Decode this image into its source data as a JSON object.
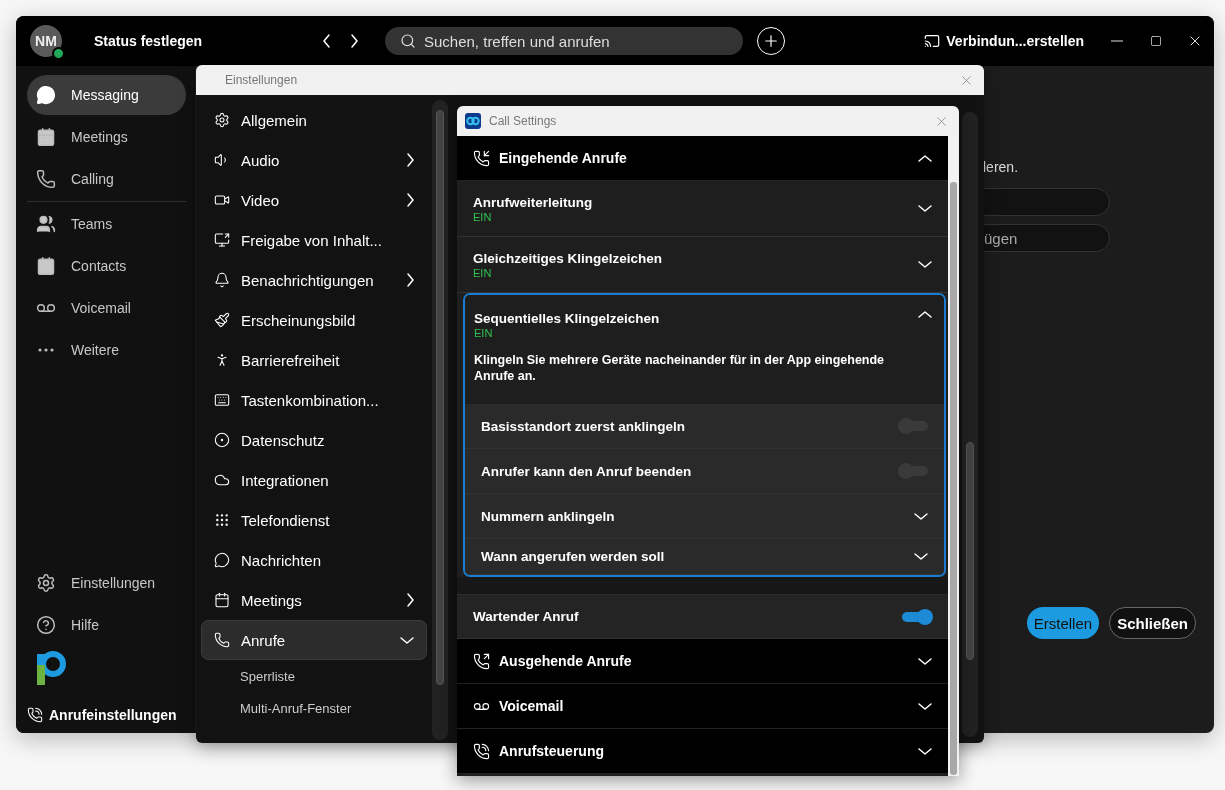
{
  "title_bar": {
    "avatar_initials": "NM",
    "status": "Status festlegen",
    "search": {
      "placeholder": "Suchen, treffen und anrufen"
    },
    "connect": "Verbindun...erstellen"
  },
  "sidebar": {
    "groups": [
      {
        "items": [
          {
            "label": "Messaging",
            "selected": true
          },
          {
            "label": "Meetings",
            "selected": false
          },
          {
            "label": "Calling",
            "selected": false
          }
        ]
      },
      {
        "items": [
          {
            "label": "Teams",
            "selected": false
          },
          {
            "label": "Contacts",
            "selected": false
          },
          {
            "label": "Voicemail",
            "selected": false
          },
          {
            "label": "Weitere",
            "selected": false
          }
        ]
      }
    ],
    "footer_items": [
      {
        "label": "Einstellungen"
      },
      {
        "label": "Hilfe"
      }
    ],
    "call_settings_link": "Anrufeinstellungen"
  },
  "background_panel": {
    "text_fragment": "leren.",
    "fields": [
      {
        "kind": "empty"
      },
      {
        "kind": "filled",
        "value": "ügen"
      }
    ],
    "buttons": [
      {
        "label": "Erstellen",
        "kind": "primary"
      },
      {
        "label": "Schließen",
        "kind": "secondary"
      }
    ]
  },
  "settings_dialog": {
    "title": "Einstellungen",
    "items": [
      {
        "label": "Allgemein",
        "submenu": false,
        "selected": false
      },
      {
        "label": "Audio",
        "submenu": true,
        "expanded": false,
        "selected": false
      },
      {
        "label": "Video",
        "submenu": true,
        "expanded": false,
        "selected": false
      },
      {
        "label": "Freigabe von Inhalt...",
        "submenu": false,
        "selected": false
      },
      {
        "label": "Benachrichtigungen",
        "submenu": true,
        "expanded": false,
        "selected": false
      },
      {
        "label": "Erscheinungsbild",
        "submenu": false,
        "selected": false
      },
      {
        "label": "Barrierefreiheit",
        "submenu": false,
        "selected": false
      },
      {
        "label": "Tastenkombination...",
        "submenu": false,
        "selected": false
      },
      {
        "label": "Datenschutz",
        "submenu": false,
        "selected": false
      },
      {
        "label": "Integrationen",
        "submenu": false,
        "selected": false
      },
      {
        "label": "Telefondienst",
        "submenu": false,
        "selected": false
      },
      {
        "label": "Nachrichten",
        "submenu": false,
        "selected": false
      },
      {
        "label": "Meetings",
        "submenu": true,
        "expanded": false,
        "selected": false
      },
      {
        "label": "Anrufe",
        "submenu": true,
        "expanded": true,
        "selected": true,
        "children": [
          {
            "label": "Sperrliste",
            "selected": false
          },
          {
            "label": "Multi-Anruf-Fenster",
            "selected": false
          }
        ]
      }
    ]
  },
  "call_settings": {
    "title": "Call Settings",
    "sections": [
      {
        "title": "Eingehende Anrufe",
        "expanded": true,
        "rows": [
          {
            "kind": "expander",
            "label": "Anrufweiterleitung",
            "status": "EIN",
            "expanded": false,
            "focused": false
          },
          {
            "kind": "expander",
            "label": "Gleichzeitiges Klingelzeichen",
            "status": "EIN",
            "expanded": false,
            "focused": false
          },
          {
            "kind": "expander",
            "label": "Sequentielles Klingelzeichen",
            "status": "EIN",
            "expanded": true,
            "focused": true,
            "description": "Klingeln Sie mehrere Geräte nacheinander für in der App eingehende Anrufe an.",
            "children": [
              {
                "kind": "toggle",
                "label": "Basisstandort zuerst anklingeln",
                "on": false
              },
              {
                "kind": "toggle",
                "label": "Anrufer kann den Anruf beenden",
                "on": false
              },
              {
                "kind": "expander",
                "label": "Nummern anklingeln",
                "expanded": false
              },
              {
                "kind": "expander",
                "label": "Wann angerufen werden soll",
                "expanded": false
              }
            ]
          },
          {
            "kind": "toggle",
            "label": "Wartender Anruf",
            "on": true
          }
        ]
      },
      {
        "title": "Ausgehende Anrufe",
        "expanded": false
      },
      {
        "title": "Voicemail",
        "expanded": false
      },
      {
        "title": "Anrufsteuerung",
        "expanded": false
      }
    ]
  }
}
